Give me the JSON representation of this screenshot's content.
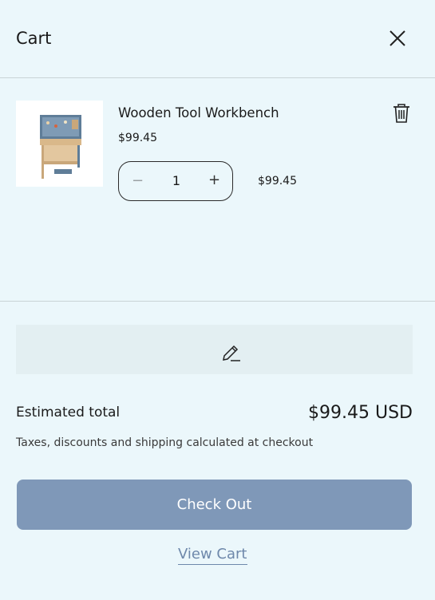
{
  "header": {
    "title": "Cart",
    "close_icon": "close-icon"
  },
  "item": {
    "name": "Wooden Tool Workbench",
    "unit_price": "$99.45",
    "quantity": "1",
    "line_total": "$99.45",
    "remove_icon": "trash-icon",
    "decrement_symbol": "−",
    "increment_symbol": "+"
  },
  "note": {
    "icon": "pencil-icon"
  },
  "summary": {
    "estimated_label": "Estimated total",
    "estimated_value": "$99.45 USD",
    "tax_note": "Taxes, discounts and shipping calculated at checkout"
  },
  "actions": {
    "checkout_label": "Check Out",
    "view_cart_label": "View Cart"
  },
  "colors": {
    "background": "#ebf7fb",
    "checkout": "#7f98b8",
    "link": "#6e88ab"
  }
}
